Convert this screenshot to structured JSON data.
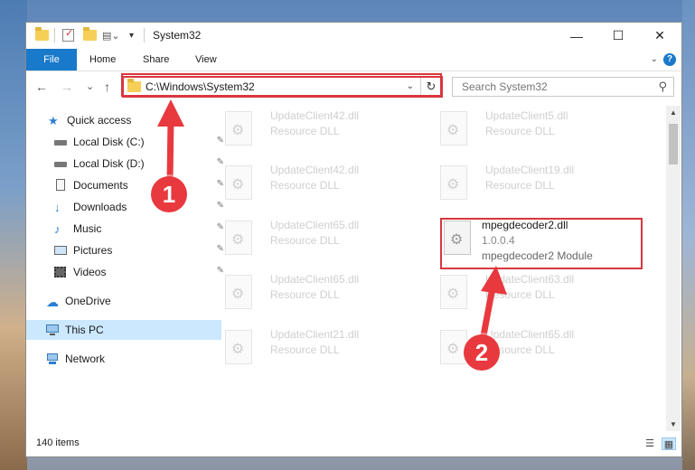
{
  "window": {
    "title": "System32",
    "minimize": "—",
    "maximize": "☐",
    "close": "✕"
  },
  "ribbon": {
    "tabs": [
      "File",
      "Home",
      "Share",
      "View"
    ],
    "help": "?"
  },
  "nav": {
    "back": "←",
    "forward": "→",
    "recent": "⌄",
    "up": "↑",
    "address": "C:\\Windows\\System32",
    "search_placeholder": "Search System32"
  },
  "sidebar": {
    "items": [
      {
        "label": "Quick access"
      },
      {
        "label": "Local Disk (C:)"
      },
      {
        "label": "Local Disk (D:)"
      },
      {
        "label": "Documents"
      },
      {
        "label": "Downloads"
      },
      {
        "label": "Music"
      },
      {
        "label": "Pictures"
      },
      {
        "label": "Videos"
      },
      {
        "label": "OneDrive"
      },
      {
        "label": "This PC"
      },
      {
        "label": "Network"
      }
    ]
  },
  "files": {
    "left": [
      {
        "name": "UpdateClient42.dll",
        "sub": "Resource DLL"
      },
      {
        "name": "UpdateClient42.dll",
        "sub": "Resource DLL"
      },
      {
        "name": "UpdateClient65.dll",
        "sub": "Resource DLL"
      },
      {
        "name": "UpdateClient65.dll",
        "sub": "Resource DLL"
      },
      {
        "name": "UpdateClient21.dll",
        "sub": "Resource DLL"
      }
    ],
    "right": [
      {
        "name": "UpdateClient5.dll",
        "sub": "Resource DLL"
      },
      {
        "name": "UpdateClient19.dll",
        "sub": "Resource DLL"
      },
      {
        "name": "mpegdecoder2.dll",
        "version": "1.0.0.4",
        "sub": "mpegdecoder2 Module"
      },
      {
        "name": "UpdateClient63.dll",
        "sub": "Resource DLL"
      },
      {
        "name": "UpdateClient65.dll",
        "sub": "Resource DLL"
      }
    ]
  },
  "status": {
    "count": "140 items"
  },
  "annotations": {
    "step1": "1",
    "step2": "2",
    "color": "#e8393f"
  }
}
